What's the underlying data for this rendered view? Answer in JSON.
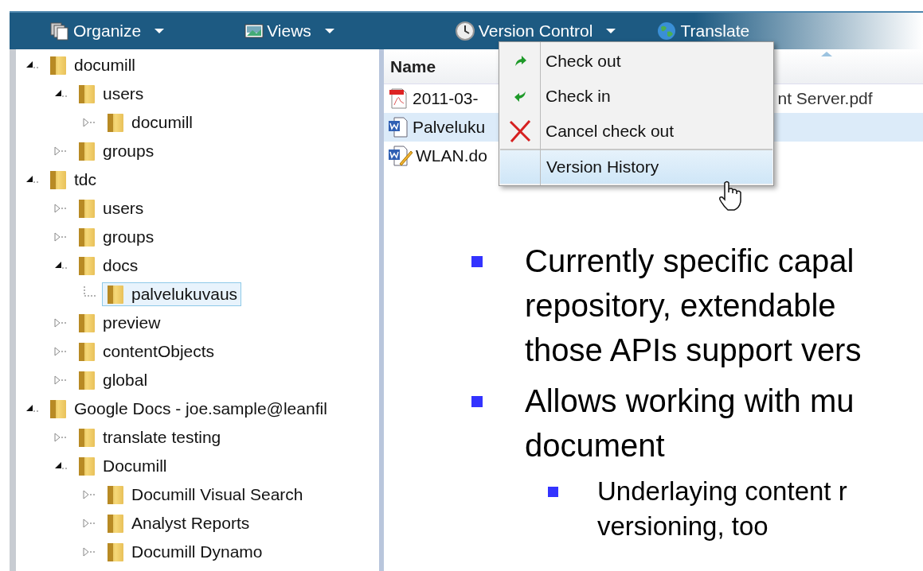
{
  "toolbar": {
    "items": [
      {
        "label": "Organize",
        "kind": "pages",
        "dropdown": true
      },
      {
        "label": "Views",
        "kind": "picture",
        "dropdown": true
      },
      {
        "label": "Version Control",
        "kind": "clock",
        "dropdown": true
      },
      {
        "label": "Translate",
        "kind": "globe",
        "dropdown": false
      }
    ]
  },
  "tree": [
    {
      "label": "documill",
      "kind": "folder",
      "expanded": true,
      "selected": false,
      "children": [
        {
          "label": "users",
          "kind": "folder",
          "expanded": true,
          "selected": false,
          "children": [
            {
              "label": "documill",
              "kind": "folder",
              "expanded": false,
              "selected": false
            }
          ]
        },
        {
          "label": "groups",
          "kind": "folder",
          "expanded": false,
          "selected": false
        }
      ]
    },
    {
      "label": "tdc",
      "kind": "folder",
      "expanded": true,
      "selected": false,
      "children": [
        {
          "label": "users",
          "kind": "folder",
          "expanded": false,
          "selected": false
        },
        {
          "label": "groups",
          "kind": "folder",
          "expanded": false,
          "selected": false
        },
        {
          "label": "docs",
          "kind": "folder",
          "expanded": true,
          "selected": false,
          "children": [
            {
              "label": "palvelukuvaus",
              "kind": "leaf",
              "selected": true
            }
          ]
        },
        {
          "label": "preview",
          "kind": "folder",
          "expanded": false,
          "selected": false
        },
        {
          "label": "contentObjects",
          "kind": "folder",
          "expanded": false,
          "selected": false
        },
        {
          "label": "global",
          "kind": "folder",
          "expanded": false,
          "selected": false
        }
      ]
    },
    {
      "label": "Google Docs - joe.sample@leanfil",
      "kind": "folder",
      "expanded": true,
      "selected": false,
      "children": [
        {
          "label": "translate testing",
          "kind": "folder",
          "expanded": false,
          "selected": false
        },
        {
          "label": "Documill",
          "kind": "folder",
          "expanded": true,
          "selected": false,
          "children": [
            {
              "label": "Documill Visual Search",
              "kind": "folder",
              "expanded": false,
              "selected": false
            },
            {
              "label": "Analyst Reports",
              "kind": "folder",
              "expanded": false,
              "selected": false
            },
            {
              "label": "Documill Dynamo",
              "kind": "folder",
              "expanded": false,
              "selected": false
            }
          ]
        }
      ]
    }
  ],
  "files": {
    "column": "Name",
    "rows": [
      {
        "kind": "pdf",
        "name": "2011-03-",
        "name_end": "nt Server.pdf",
        "selected": false
      },
      {
        "kind": "word",
        "name": "Palveluku",
        "selected": true
      },
      {
        "kind": "word-edit",
        "name": "WLAN.do",
        "selected": false
      }
    ]
  },
  "menu": {
    "items": [
      {
        "label": "Check out",
        "kind": "out",
        "selected": false
      },
      {
        "label": "Check in",
        "kind": "in",
        "selected": false
      },
      {
        "label": "Cancel check out",
        "kind": "cancel",
        "selected": false
      },
      {
        "label": "Version History",
        "kind": "plain",
        "selected": true
      }
    ]
  },
  "bullets": [
    {
      "lines": [
        "Currently specific capal",
        "repository, extendable",
        "those APIs support vers"
      ]
    },
    {
      "lines": [
        "Allows working with mu",
        "document"
      ],
      "children": [
        {
          "lines": [
            "Underlaying content r",
            "versioning, too"
          ]
        }
      ]
    }
  ]
}
